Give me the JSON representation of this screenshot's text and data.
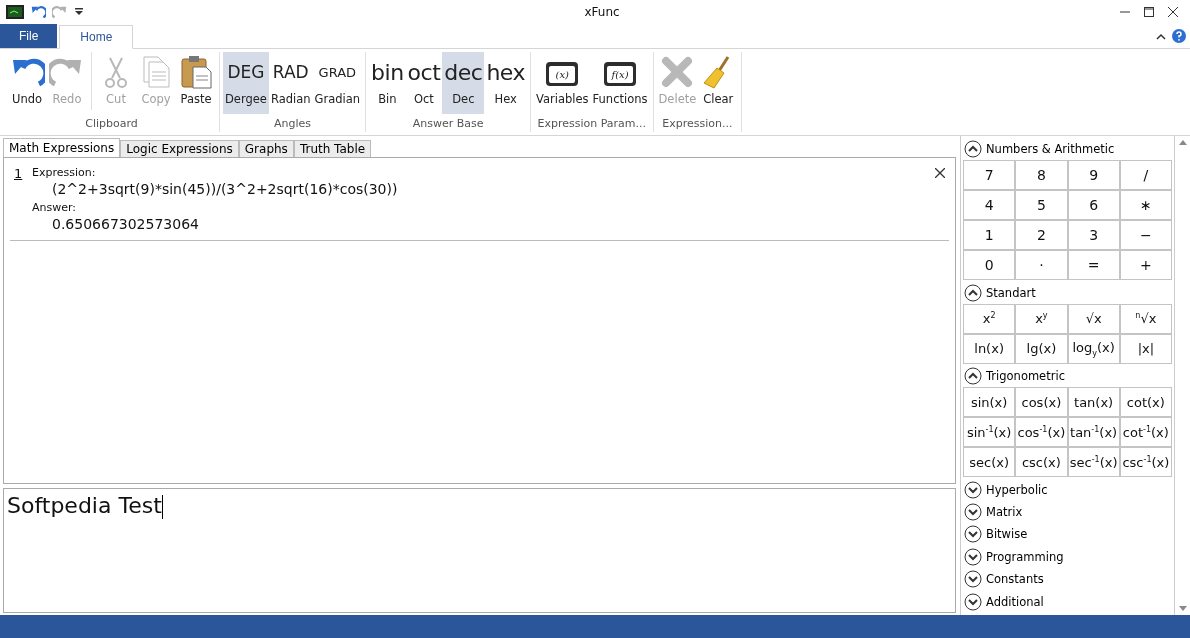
{
  "window": {
    "title": "xFunc"
  },
  "ribbon_tabs": [
    {
      "label": "File",
      "kind": "file"
    },
    {
      "label": "Home",
      "kind": "tab",
      "selected": true
    }
  ],
  "ribbon_groups": [
    {
      "label": "Clipboard",
      "items": [
        {
          "kind": "undo",
          "label": "Undo",
          "disabled": false
        },
        {
          "kind": "redo",
          "label": "Redo",
          "disabled": true
        },
        {
          "kind": "separator"
        },
        {
          "kind": "cut",
          "label": "Cut",
          "disabled": true
        },
        {
          "kind": "copy",
          "label": "Copy",
          "disabled": true
        },
        {
          "kind": "paste",
          "label": "Paste",
          "disabled": false
        }
      ]
    },
    {
      "label": "Angles",
      "items": [
        {
          "kind": "text",
          "glyph": "DEG",
          "label": "Dergee",
          "selected": true
        },
        {
          "kind": "text",
          "glyph": "RAD",
          "label": "Radian",
          "selected": false
        },
        {
          "kind": "small-text",
          "glyph": "GRAD",
          "label": "Gradian",
          "selected": false
        }
      ]
    },
    {
      "label": "Answer Base",
      "items": [
        {
          "kind": "big-text",
          "glyph": "bin",
          "label": "Bin",
          "selected": false
        },
        {
          "kind": "big-text",
          "glyph": "oct",
          "label": "Oct",
          "selected": false
        },
        {
          "kind": "big-text",
          "glyph": "dec",
          "label": "Dec",
          "selected": true
        },
        {
          "kind": "big-text",
          "glyph": "hex",
          "label": "Hex",
          "selected": false
        }
      ]
    },
    {
      "label": "Expression Param...",
      "items": [
        {
          "kind": "param",
          "glyph": "(x)",
          "label": "Variables"
        },
        {
          "kind": "param",
          "glyph": "f(x)",
          "label": "Functions"
        }
      ]
    },
    {
      "label": "Expression...",
      "items": [
        {
          "kind": "delete",
          "label": "Delete",
          "disabled": true
        },
        {
          "kind": "clear",
          "label": "Clear",
          "disabled": false
        }
      ]
    }
  ],
  "doc_tabs": [
    {
      "label": "Math Expressions",
      "selected": true
    },
    {
      "label": "Logic Expressions",
      "selected": false
    },
    {
      "label": "Graphs",
      "selected": false
    },
    {
      "label": "Truth Table",
      "selected": false
    }
  ],
  "expressions": [
    {
      "index": "1",
      "expression_label": "Expression:",
      "expression": "(2^2+3sqrt(9)*sin(45))/(3^2+2sqrt(16)*cos(30))",
      "answer_label": "Answer:",
      "answer": "0.650667302573064"
    }
  ],
  "input": {
    "value": "Softpedia Test"
  },
  "sections": [
    {
      "title": "Numbers & Arithmetic",
      "expanded": true,
      "keys": [
        "7",
        "8",
        "9",
        "/",
        "4",
        "5",
        "6",
        "∗",
        "1",
        "2",
        "3",
        "−",
        "0",
        "·",
        "=",
        "+"
      ]
    },
    {
      "title": "Standart",
      "expanded": true,
      "keys": [
        "x$^{2}$",
        "x$^{y}$",
        "√x",
        "$^{n}$√x",
        "ln(x)",
        "lg(x)",
        "log$_{y}$(x)",
        "|x|"
      ]
    },
    {
      "title": "Trigonometric",
      "expanded": true,
      "keys": [
        "sin(x)",
        "cos(x)",
        "tan(x)",
        "cot(x)",
        "sin$^{-1}$(x)",
        "cos$^{-1}$(x)",
        "tan$^{-1}$(x)",
        "cot$^{-1}$(x)",
        "sec(x)",
        "csc(x)",
        "sec$^{-1}$(x)",
        "csc$^{-1}$(x)"
      ]
    },
    {
      "title": "Hyperbolic",
      "expanded": false
    },
    {
      "title": "Matrix",
      "expanded": false
    },
    {
      "title": "Bitwise",
      "expanded": false
    },
    {
      "title": "Programming",
      "expanded": false
    },
    {
      "title": "Constants",
      "expanded": false
    },
    {
      "title": "Additional",
      "expanded": false
    }
  ]
}
